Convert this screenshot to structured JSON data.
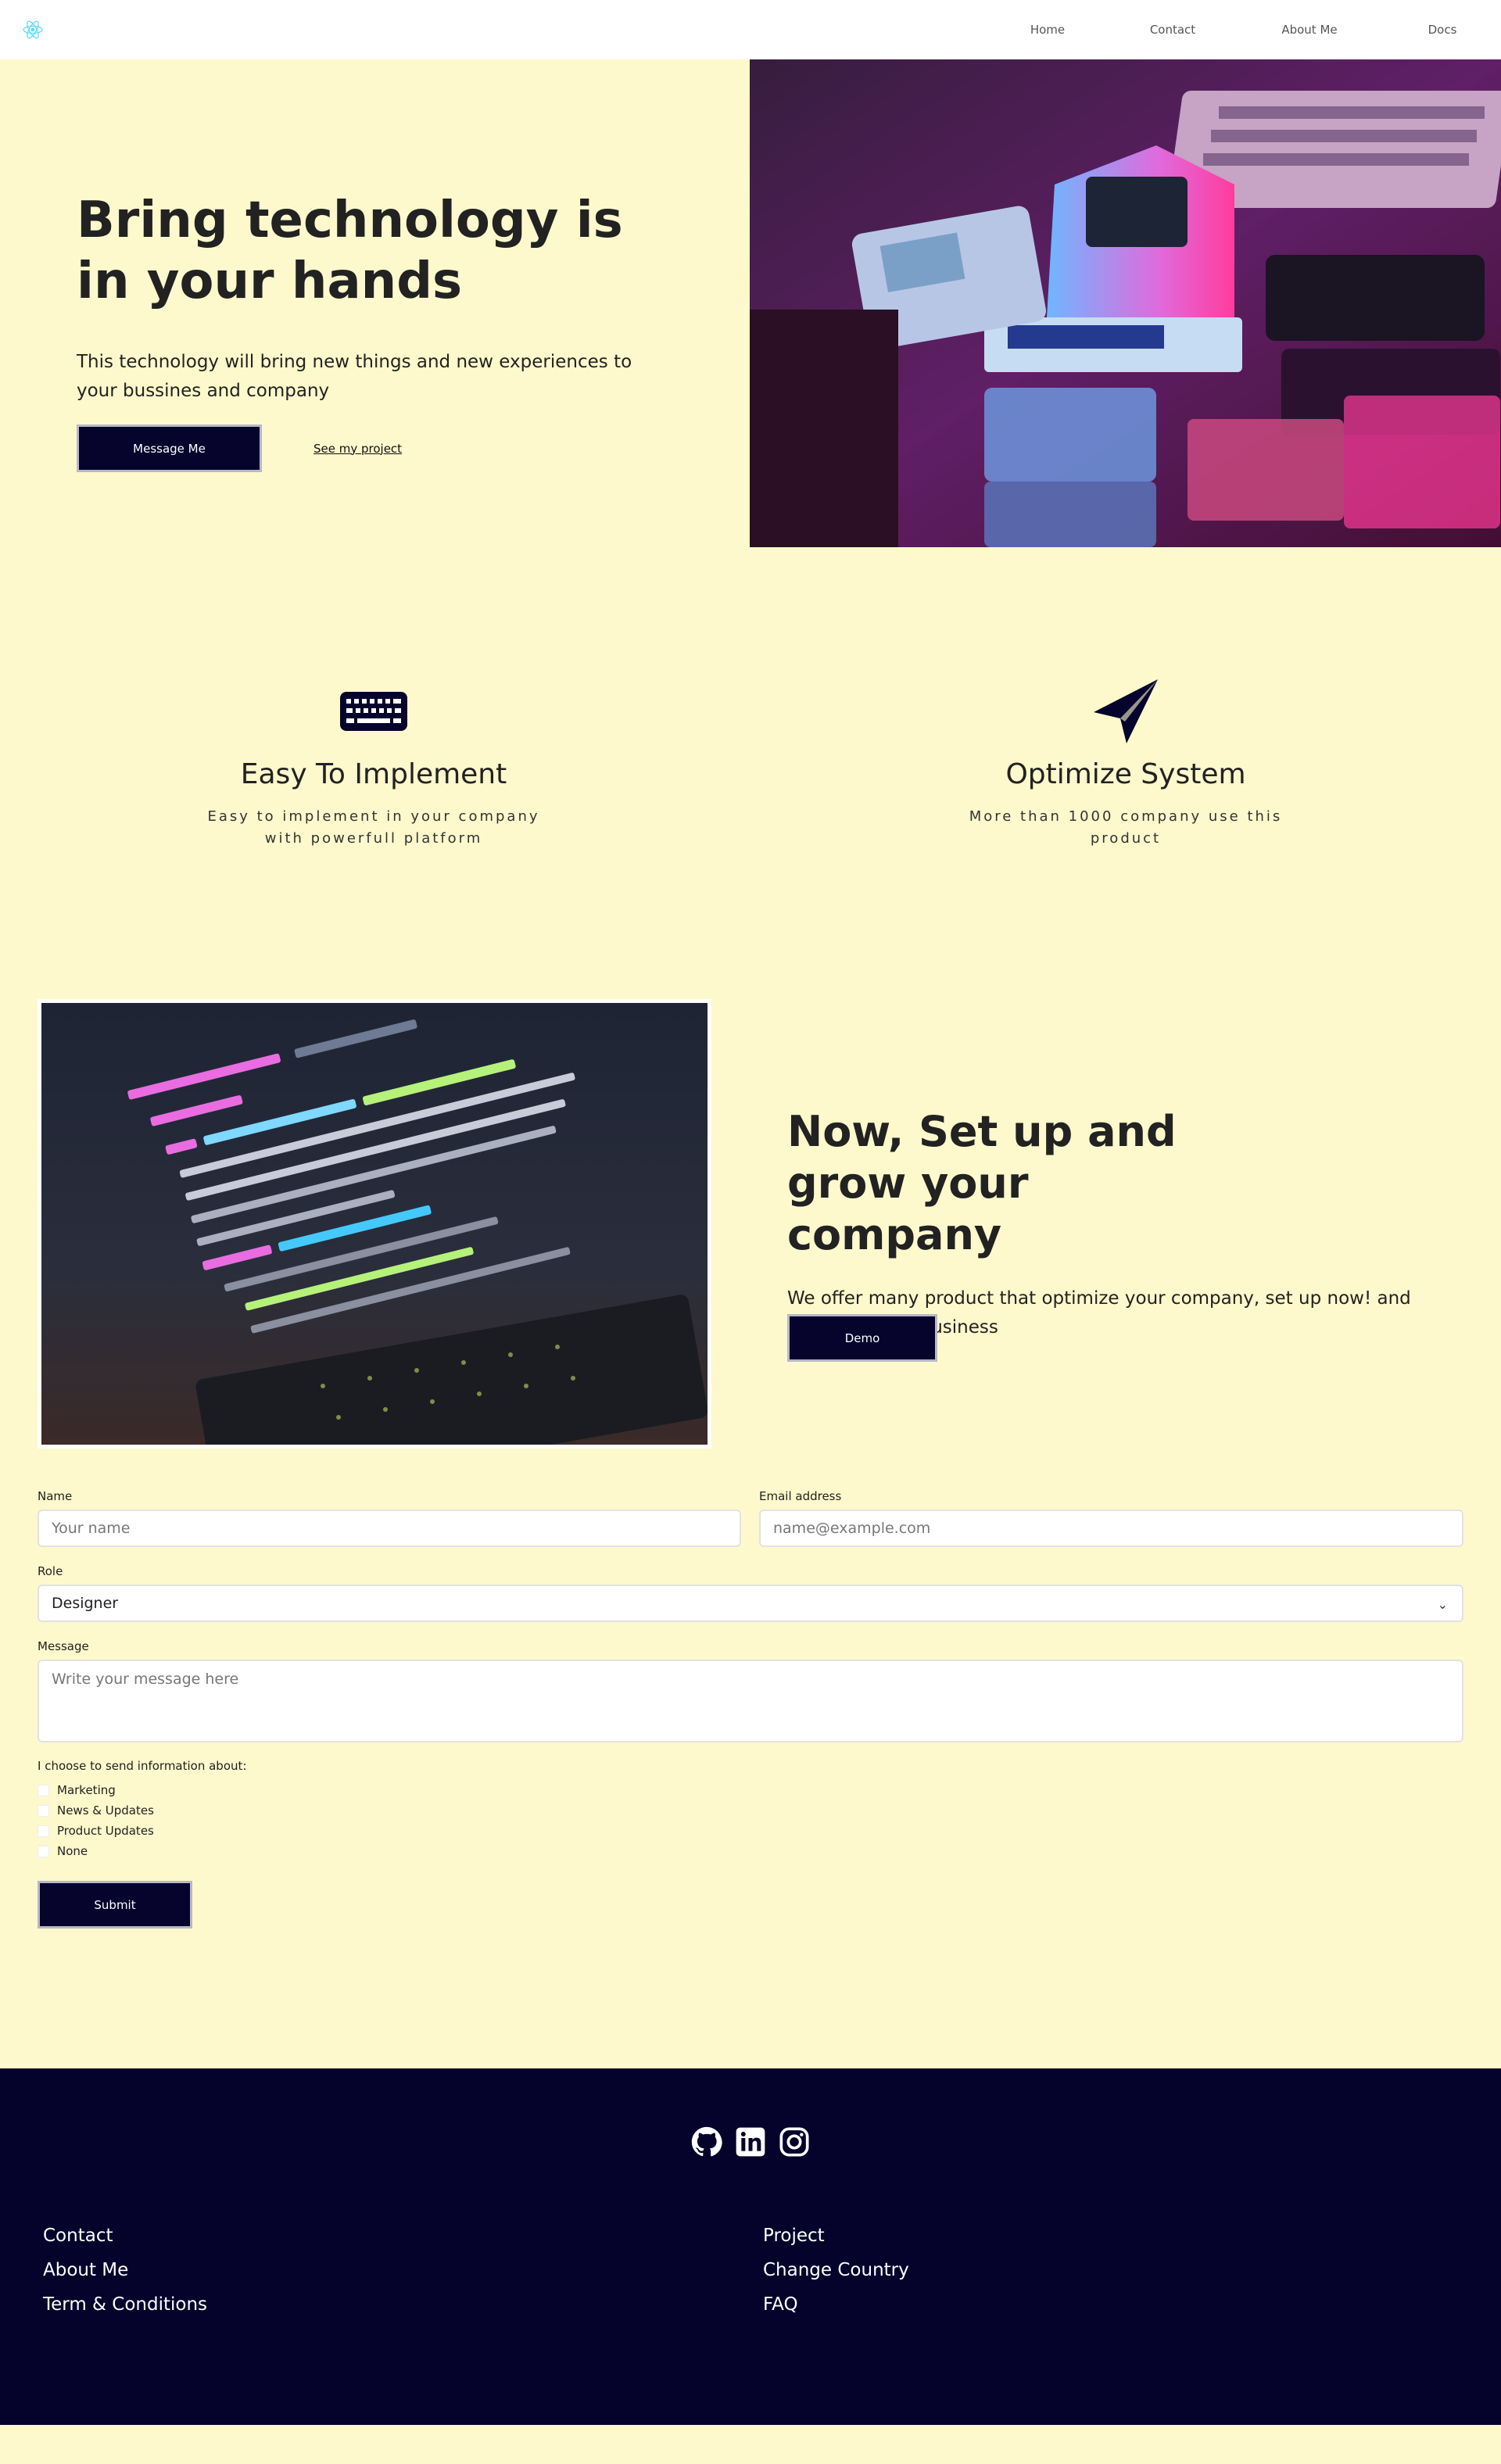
{
  "nav": {
    "logo": "react-logo",
    "links": [
      "Home",
      "Contact",
      "About Me",
      "Docs"
    ]
  },
  "hero": {
    "title": "Bring technology is in your hands",
    "description": "This technology will bring new things and new experiences to your bussines and company",
    "primary_button": "Message Me",
    "secondary_link": "See my project"
  },
  "features": [
    {
      "icon": "keyboard-icon",
      "title": "Easy To Implement",
      "text": "Easy to implement in your company with powerfull platform"
    },
    {
      "icon": "paper-plane-icon",
      "title": "Optimize System",
      "text": "More than 1000 company use this product"
    }
  ],
  "setup": {
    "title": "Now, Set up and grow your company",
    "description": "We offer many product that optimize your company, set up now! and group up your business",
    "button": "Demo"
  },
  "form": {
    "name_label": "Name",
    "name_placeholder": "Your name",
    "email_label": "Email address",
    "email_placeholder": "name@example.com",
    "role_label": "Role",
    "role_value": "Designer",
    "message_label": "Message",
    "message_placeholder": "Write your message here",
    "choices_label": "I choose to send information about:",
    "choices": [
      "Marketing",
      "News & Updates",
      "Product Updates",
      "None"
    ],
    "submit": "Submit"
  },
  "footer": {
    "social_icons": [
      "github-icon",
      "linkedin-icon",
      "instagram-icon"
    ],
    "col1": [
      "Contact",
      "About Me",
      "Term & Conditions"
    ],
    "col2": [
      "Project",
      "Change Country",
      "FAQ"
    ]
  },
  "colors": {
    "background": "#fdf9cc",
    "primary": "#06032c",
    "footer": "#05022b"
  }
}
